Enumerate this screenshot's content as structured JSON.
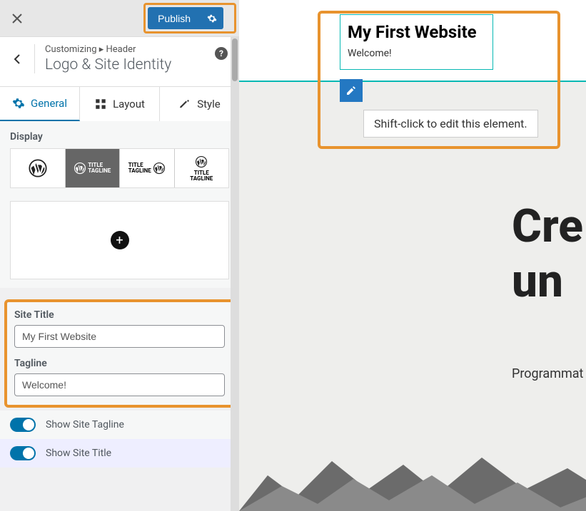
{
  "topbar": {
    "publish_label": "Publish"
  },
  "breadcrumb": {
    "parent": "Customizing ▸ Header",
    "title": "Logo & Site Identity"
  },
  "tabs": {
    "general": "General",
    "layout": "Layout",
    "style": "Style"
  },
  "display": {
    "label": "Display"
  },
  "fields": {
    "site_title_label": "Site Title",
    "site_title_value": "My First Website",
    "tagline_label": "Tagline",
    "tagline_value": "Welcome!"
  },
  "toggles": {
    "show_tagline": "Show Site Tagline",
    "show_title": "Show Site Title"
  },
  "preview": {
    "site_title": "My First Website",
    "tagline": "Welcome!",
    "tooltip": "Shift-click to edit this element.",
    "hero_line1": "Cre",
    "hero_line2": "un",
    "hero_sub": "Programmat"
  }
}
